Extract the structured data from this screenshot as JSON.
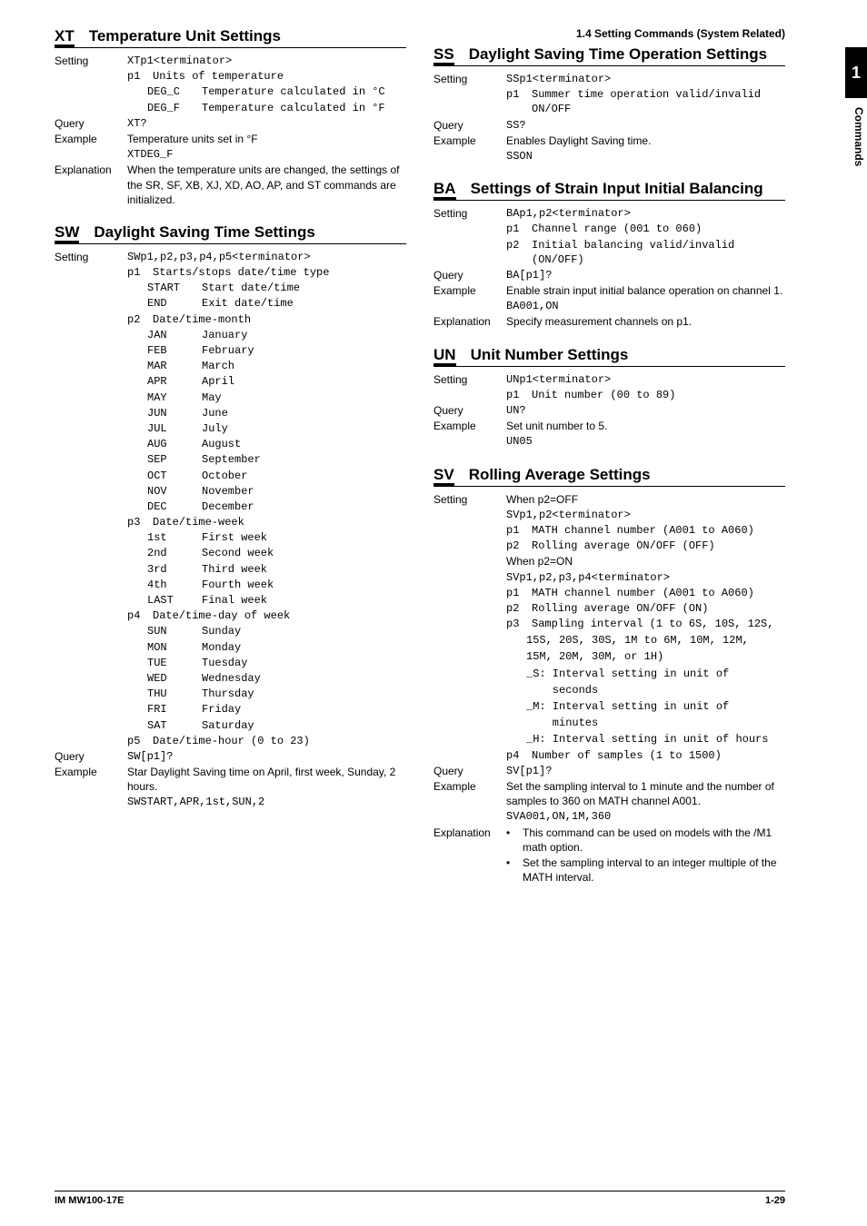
{
  "section_header": "1.4  Setting Commands (System Related)",
  "sidetab": {
    "num": "1",
    "label": "Commands"
  },
  "footer": {
    "left": "IM MW100-17E",
    "right": "1-29"
  },
  "labels": {
    "Setting": "Setting",
    "Query": "Query",
    "Example": "Example",
    "Explanation": "Explanation"
  },
  "XT": {
    "code": "XT",
    "title": "Temperature Unit Settings",
    "setting_syn": "XTp1<terminator>",
    "p1_label": "p1",
    "p1_desc": "Units of temperature",
    "deg_c_key": "DEG_C",
    "deg_c_val": "Temperature calculated in °C",
    "deg_f_key": "DEG_F",
    "deg_f_val": "Temperature calculated in °F",
    "query": "XT?",
    "example_desc": "Temperature units set in °F",
    "example_code": "XTDEG_F",
    "expl": "When the temperature units are changed, the settings of the SR, SF, XB, XJ, XD, AO, AP, and ST commands are initialized."
  },
  "SW": {
    "code": "SW",
    "title": "Daylight Saving Time Settings",
    "setting_syn": "SWp1,p2,p3,p4,p5<terminator>",
    "p1_label": "p1",
    "p1_desc": "Starts/stops date/time type",
    "p1_start_k": "START",
    "p1_start_v": "Start date/time",
    "p1_end_k": "END",
    "p1_end_v": "Exit date/time",
    "p2_label": "p2",
    "p2_desc": "Date/time-month",
    "months": [
      {
        "k": "JAN",
        "v": "January"
      },
      {
        "k": "FEB",
        "v": "February"
      },
      {
        "k": "MAR",
        "v": "March"
      },
      {
        "k": "APR",
        "v": "April"
      },
      {
        "k": "MAY",
        "v": "May"
      },
      {
        "k": "JUN",
        "v": "June"
      },
      {
        "k": "JUL",
        "v": "July"
      },
      {
        "k": "AUG",
        "v": "August"
      },
      {
        "k": "SEP",
        "v": "September"
      },
      {
        "k": "OCT",
        "v": "October"
      },
      {
        "k": "NOV",
        "v": "November"
      },
      {
        "k": "DEC",
        "v": "December"
      }
    ],
    "p3_label": "p3",
    "p3_desc": "Date/time-week",
    "weeks": [
      {
        "k": "1st",
        "v": "First week"
      },
      {
        "k": "2nd",
        "v": "Second week"
      },
      {
        "k": "3rd",
        "v": "Third week"
      },
      {
        "k": "4th",
        "v": "Fourth week"
      },
      {
        "k": "LAST",
        "v": "Final week"
      }
    ],
    "p4_label": "p4",
    "p4_desc": "Date/time-day of week",
    "days": [
      {
        "k": "SUN",
        "v": "Sunday"
      },
      {
        "k": "MON",
        "v": "Monday"
      },
      {
        "k": "TUE",
        "v": "Tuesday"
      },
      {
        "k": "WED",
        "v": "Wednesday"
      },
      {
        "k": "THU",
        "v": "Thursday"
      },
      {
        "k": "FRI",
        "v": "Friday"
      },
      {
        "k": "SAT",
        "v": "Saturday"
      }
    ],
    "p5_label": "p5",
    "p5_desc": "Date/time-hour (0 to 23)",
    "query": "SW[p1]?",
    "example_desc": "Star Daylight Saving time on April, first week, Sunday, 2 hours.",
    "example_code": "SWSTART,APR,1st,SUN,2"
  },
  "SS": {
    "code": "SS",
    "title": "Daylight Saving Time Operation Settings",
    "setting_syn": "SSp1<terminator>",
    "p1_label": "p1",
    "p1_desc": "Summer time operation valid/invalid ON/OFF",
    "query": "SS?",
    "example_desc": "Enables Daylight Saving time.",
    "example_code": "SSON"
  },
  "BA": {
    "code": "BA",
    "title": "Settings of Strain Input Initial Balancing",
    "setting_syn": "BAp1,p2<terminator>",
    "p1_label": "p1",
    "p1_desc": "Channel range (001 to 060)",
    "p2_label": "p2",
    "p2_desc": "Initial balancing valid/invalid (ON/OFF)",
    "query": "BA[p1]?",
    "example_desc": "Enable strain input initial balance operation on channel 1.",
    "example_code": "BA001,ON",
    "expl": "Specify measurement channels on p1."
  },
  "UN": {
    "code": "UN",
    "title": "Unit Number Settings",
    "setting_syn": "UNp1<terminator>",
    "p1_label": "p1",
    "p1_desc": "Unit number (00 to 89)",
    "query": "UN?",
    "example_desc": "Set unit number to 5.",
    "example_code": "UN05"
  },
  "SV": {
    "code": "SV",
    "title": "Rolling Average Settings",
    "when_off": "When p2=OFF",
    "syn_off": "SVp1,p2<terminator>",
    "off_p1_label": "p1",
    "off_p1_desc": "MATH channel number (A001 to A060)",
    "off_p2_label": "p2",
    "off_p2_desc": "Rolling average ON/OFF (OFF)",
    "when_on": "When p2=ON",
    "syn_on": "SVp1,p2,p3,p4<terminator>",
    "on_p1_label": "p1",
    "on_p1_desc": "MATH channel number (A001 to A060)",
    "on_p2_label": "p2",
    "on_p2_desc": "Rolling average ON/OFF (ON)",
    "on_p3_label": "p3",
    "on_p3_l1": "Sampling interval (1 to 6S, 10S, 12S,",
    "on_p3_l2": "15S, 20S, 30S, 1M to 6M, 10M, 12M,",
    "on_p3_l3": "15M, 20M, 30M, or 1H)",
    "on_p3_s1": "_S: Interval setting in unit of",
    "on_p3_s1b": "    seconds",
    "on_p3_m1": "_M: Interval setting in unit of",
    "on_p3_m1b": "    minutes",
    "on_p3_h1": "_H: Interval setting in unit of hours",
    "on_p4_label": "p4",
    "on_p4_desc": "Number of samples (1 to 1500)",
    "query": "SV[p1]?",
    "example_desc": "Set the sampling interval to 1 minute and the number of samples to 360 on MATH channel A001.",
    "example_code": "SVA001,ON,1M,360",
    "expl_b1": "This command can be used on models with the /M1 math option.",
    "expl_b2": "Set the sampling interval to an integer multiple of the MATH interval."
  }
}
